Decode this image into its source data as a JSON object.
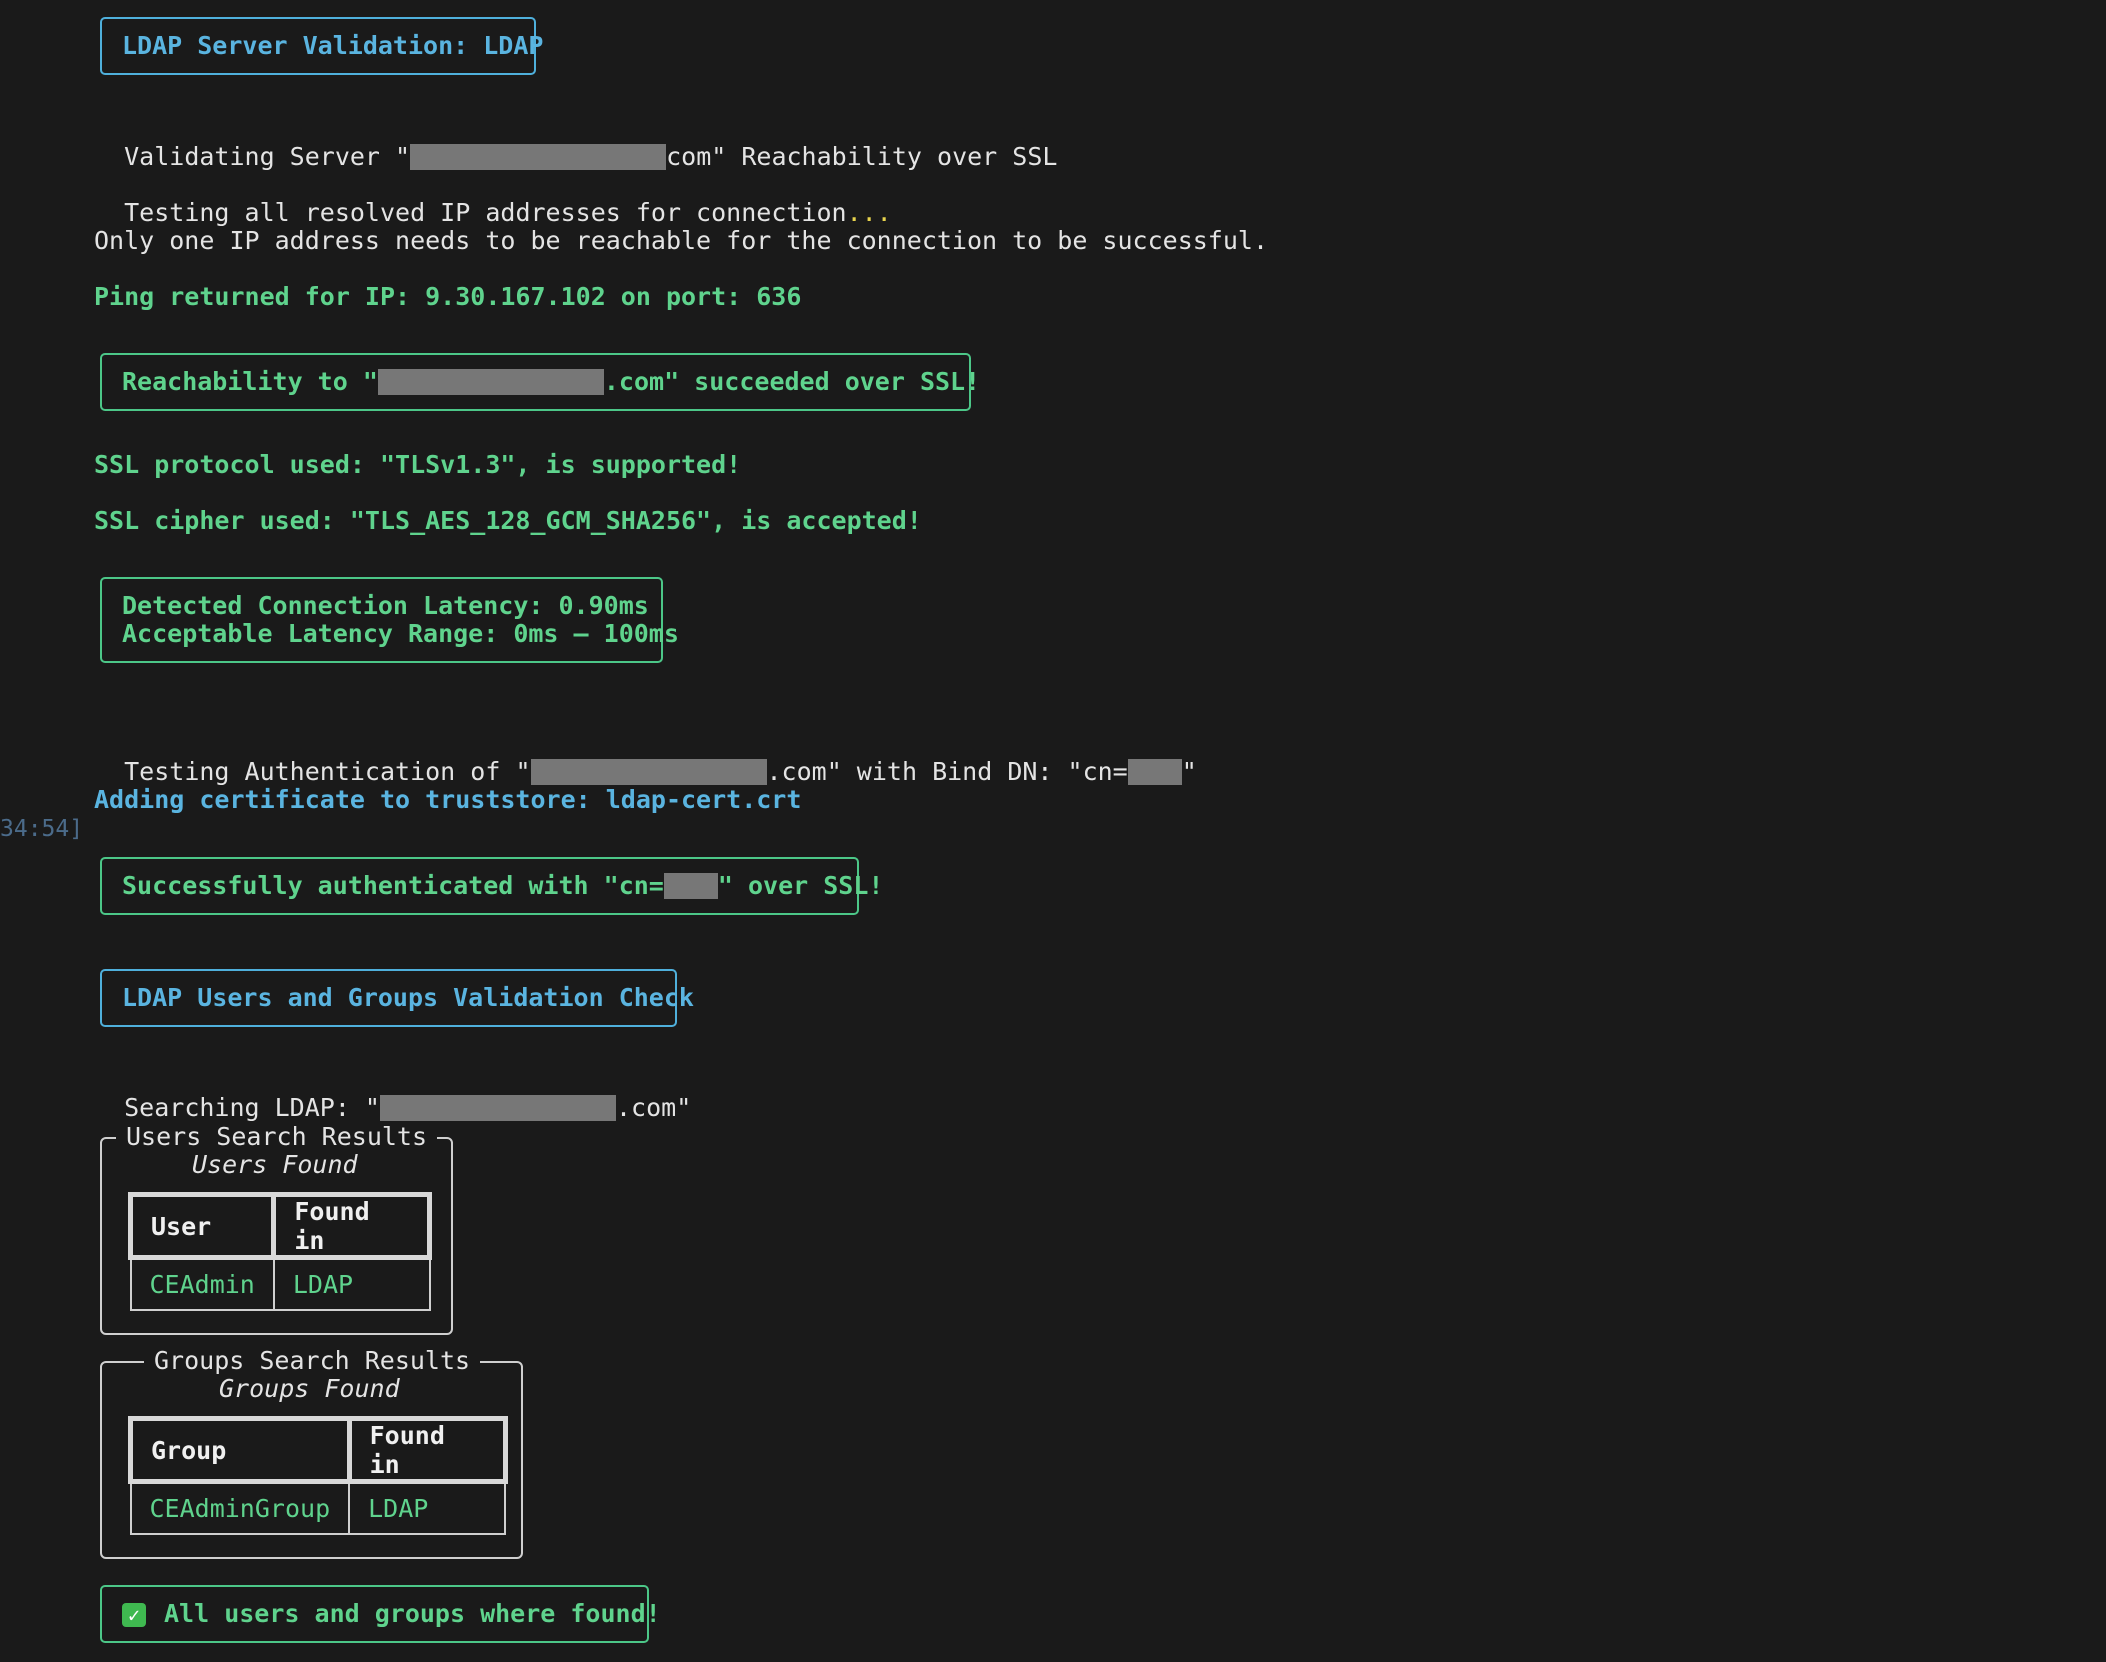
{
  "ldap_header": "LDAP Server Validation: LDAP",
  "validating_prefix": "Validating Server \"",
  "validating_suffix": "com\" Reachability over SSL",
  "testing_ips_text": "Testing all resolved IP addresses for connection",
  "testing_ips_ellipsis": "...",
  "only_one_ip_text": "Only one IP address needs to be reachable for the connection to be successful.",
  "ping_text": "Ping returned for IP: 9.30.167.102 on port: 636",
  "reachability_prefix": "Reachability to \"",
  "reachability_suffix": ".com\" succeeded over SSL!",
  "ssl_protocol_text": "SSL protocol used: \"TLSv1.3\", is supported!",
  "ssl_cipher_text": "SSL cipher used: \"TLS_AES_128_GCM_SHA256\", is accepted!",
  "latency_detected": "Detected Connection Latency: 0.90ms",
  "latency_range": "Acceptable Latency Range: 0ms – 100ms",
  "auth_prefix": "Testing Authentication of \"",
  "auth_middle": ".com\" with Bind DN: \"cn=",
  "auth_suffix": "\"",
  "adding_cert_text": "Adding certificate to truststore: ldap-cert.crt",
  "timestamp_fragment": "34:54]",
  "auth_success_prefix": "Successfully authenticated with \"cn=",
  "auth_success_suffix": "\" over SSL!",
  "users_groups_header": "LDAP Users and Groups Validation Check",
  "searching_prefix": "Searching LDAP: \"",
  "searching_suffix": ".com\"",
  "users_panel": {
    "title": "Users Search Results",
    "caption": "Users Found",
    "headers": [
      "User",
      "Found in"
    ],
    "rows": [
      [
        "CEAdmin",
        "LDAP"
      ]
    ]
  },
  "groups_panel": {
    "title": "Groups Search Results",
    "caption": "Groups Found",
    "headers": [
      "Group",
      "Found in"
    ],
    "rows": [
      [
        "CEAdminGroup",
        "LDAP"
      ]
    ]
  },
  "final_icon": "check-mark-icon",
  "final_text": "All users and groups where found!",
  "colors": {
    "background": "#1a1a1a",
    "success_green": "#5fd38d",
    "info_blue": "#5ab4e0",
    "ellipsis_yellow": "#e8d44d"
  }
}
